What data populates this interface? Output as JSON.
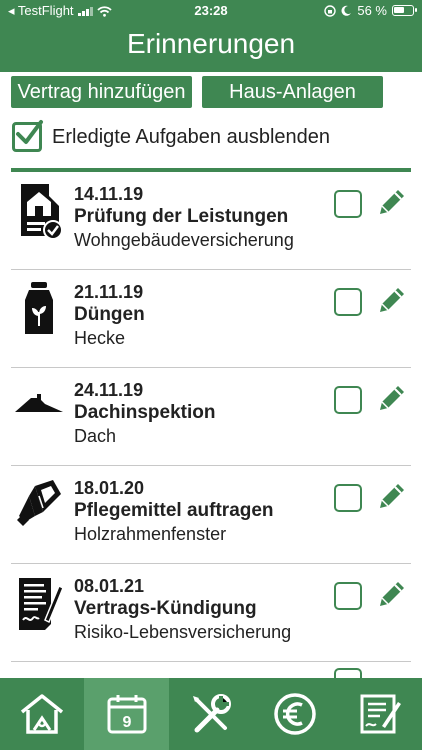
{
  "status_bar": {
    "carrier": "◂ TestFlight",
    "time": "23:28",
    "battery": "56 %"
  },
  "header": {
    "title": "Erinnerungen"
  },
  "buttons": {
    "add_contract": "Vertrag hinzufügen",
    "house_assets": "Haus-Anlagen"
  },
  "filter": {
    "hide_done_label": "Erledigte Aufgaben ausblenden",
    "hide_done_checked": true
  },
  "tasks": [
    {
      "date": "14.11.19",
      "name": "Prüfung der Leistungen",
      "object": "Wohngebäudeversicherung",
      "icon": "house-document-icon",
      "done": false
    },
    {
      "date": "21.11.19",
      "name": "Düngen",
      "object": "Hecke",
      "icon": "fertilizer-bag-icon",
      "done": false
    },
    {
      "date": "24.11.19",
      "name": "Dachinspektion",
      "object": "Dach",
      "icon": "roof-icon",
      "done": false
    },
    {
      "date": "18.01.20",
      "name": "Pflegemittel auftragen",
      "object": "Holzrahmenfenster",
      "icon": "paint-tube-icon",
      "done": false
    },
    {
      "date": "08.01.21",
      "name": "Vertrags-Kündigung",
      "object": "Risiko-Lebensversicherung",
      "icon": "contract-sign-icon",
      "done": false
    }
  ],
  "tabbar": {
    "active": "calendar",
    "calendar_day": "9",
    "tabs": [
      "home-icon",
      "calendar-icon",
      "tools-icon",
      "euro-icon",
      "notes-icon"
    ]
  },
  "colors": {
    "brand_green": "#3f8752",
    "active_tab": "#5aa06c"
  }
}
